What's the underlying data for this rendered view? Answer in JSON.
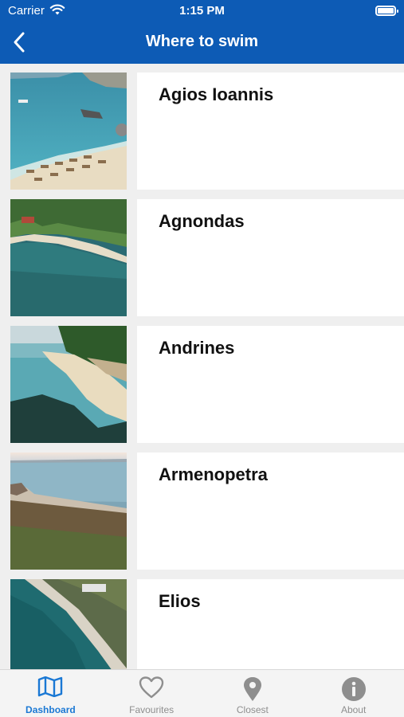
{
  "status_bar": {
    "carrier": "Carrier",
    "time": "1:15 PM"
  },
  "nav": {
    "title": "Where to swim"
  },
  "beaches": [
    {
      "name": "Agios Ioannis"
    },
    {
      "name": "Agnondas"
    },
    {
      "name": "Andrines"
    },
    {
      "name": "Armenopetra"
    },
    {
      "name": "Elios"
    }
  ],
  "tabs": [
    {
      "label": "Dashboard",
      "icon": "map-icon",
      "active": true
    },
    {
      "label": "Favourites",
      "icon": "heart-icon",
      "active": false
    },
    {
      "label": "Closest",
      "icon": "location-pin-icon",
      "active": false
    },
    {
      "label": "About",
      "icon": "info-icon",
      "active": false
    }
  ],
  "colors": {
    "nav_bg": "#0d5bb5",
    "tab_active": "#1a78d4",
    "tab_inactive": "#8e8e8e"
  }
}
